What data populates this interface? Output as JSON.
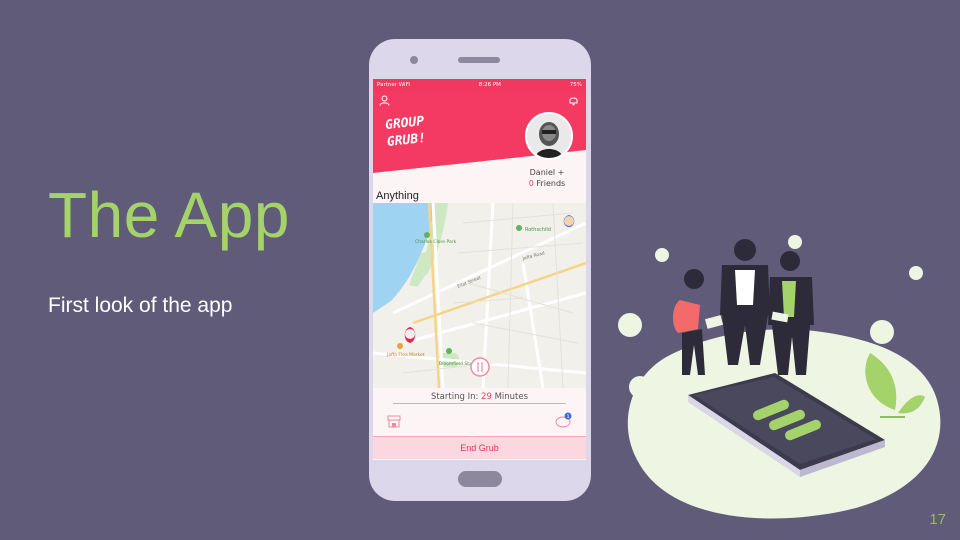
{
  "slide": {
    "title": "The App",
    "subtitle": "First look of the app",
    "page_number": "17"
  },
  "app": {
    "status": {
      "carrier": "Partner WiFi",
      "time": "8:26 PM",
      "battery": "75%"
    },
    "logo_line1": "GROUP",
    "logo_line2": "GRUB!",
    "user_name": "Daniel +",
    "friend_count": "0",
    "friends_label": "Friends",
    "mode": "Anything",
    "map_labels": {
      "park": "Charles Clore Park",
      "place": "Rothschild",
      "jaffa_rd": "Jaffa Road",
      "elifelet": "Eilat Street",
      "market": "Jaffa Flea Market",
      "stadium": "Bloomfield Stadium"
    },
    "timer_prefix": "Starting In:",
    "timer_value": "29",
    "timer_suffix": "Minutes",
    "end_button": "End Grub",
    "chat_badge": "1"
  },
  "colors": {
    "background": "#5f5b79",
    "accent_green": "#a3d36a",
    "app_pink": "#f43a62"
  }
}
